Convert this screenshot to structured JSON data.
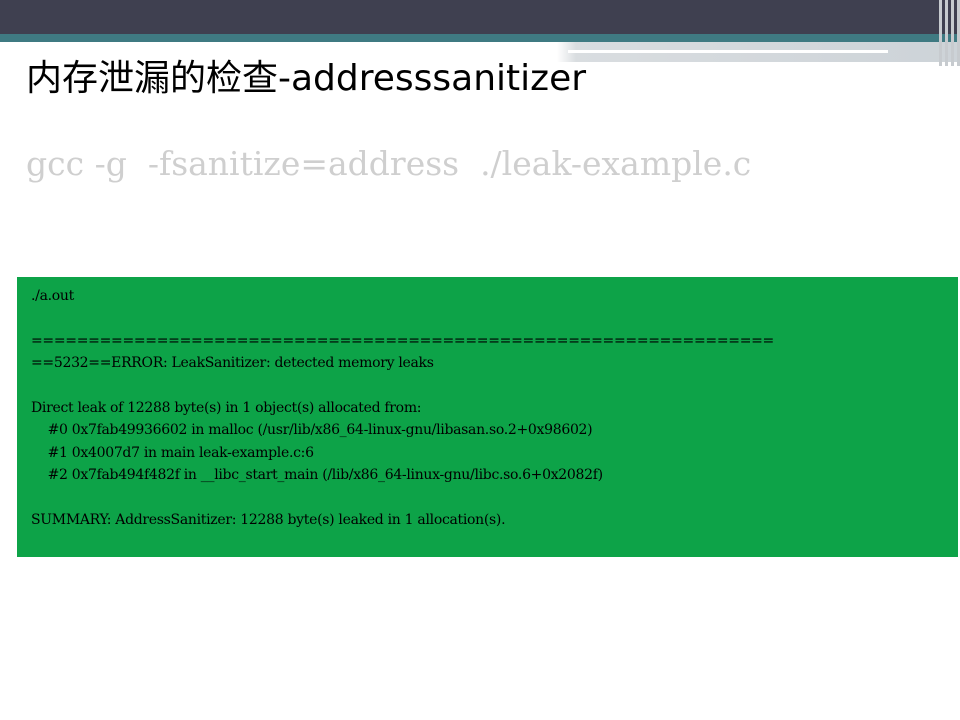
{
  "slide": {
    "title": "内存泄漏的检查-addresssanitizer",
    "command": "gcc -g  -fsanitize=address  ./leak-example.c",
    "output": {
      "lines": [
        "./a.out",
        "",
        "=================================================================",
        "==5232==ERROR: LeakSanitizer: detected memory leaks",
        "",
        "Direct leak of 12288 byte(s) in 1 object(s) allocated from:",
        "    #0 0x7fab49936602 in malloc (/usr/lib/x86_64-linux-gnu/libasan.so.2+0x98602)",
        "    #1 0x4007d7 in main leak-example.c:6",
        "    #2 0x7fab494f482f in __libc_start_main (/lib/x86_64-linux-gnu/libc.so.6+0x2082f)",
        "",
        "SUMMARY: AddressSanitizer: 12288 byte(s) leaked in 1 allocation(s)."
      ]
    }
  },
  "colors": {
    "header_band": "#3f4050",
    "header_accent": "#3f7a82",
    "output_background": "#0da348",
    "command_text": "#cfcfcf"
  }
}
